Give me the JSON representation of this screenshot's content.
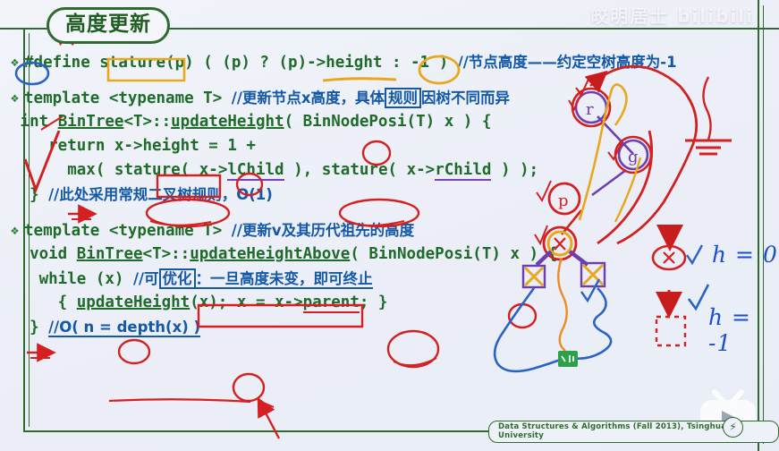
{
  "slide": {
    "title": "高度更新",
    "footer_note": "Data Structures & Algorithms (Fall 2013), Tsinghua University",
    "footer_badge_icon": "lightning-icon",
    "watermark_top": "皎明居士 bilibili",
    "watermark_logo_icon": "bilibili-tv-play-icon"
  },
  "colors": {
    "frame_green": "#2f6b2f",
    "code_green": "#1e6b2a",
    "comment_blue": "#1458a8",
    "ink_red": "#d42020",
    "ink_blue": "#1a4fd0",
    "ink_orange": "#e8a81c",
    "ink_purple": "#7b3fbf",
    "background": "#eef1f8"
  },
  "code": {
    "bullet_glyph": "❖",
    "lines": [
      {
        "id": "line-define",
        "bullet": true,
        "segments": [
          {
            "t": "#define ",
            "k": "code"
          },
          {
            "t": "stature",
            "k": "code"
          },
          {
            "t": "(p) ( (p) ? (p)->",
            "k": "code"
          },
          {
            "t": "height",
            "k": "code"
          },
          {
            "t": " : ",
            "k": "code"
          },
          {
            "t": "-1",
            "k": "code"
          },
          {
            "t": " ) ",
            "k": "code"
          },
          {
            "t": "//节点高度——约定空树高度为-1",
            "k": "cn"
          }
        ]
      },
      {
        "id": "line-template-1",
        "bullet": true,
        "segments": [
          {
            "t": "template <typename T> ",
            "k": "code"
          },
          {
            "t": "//更新节点x高度，具体",
            "k": "cn"
          },
          {
            "t": "规则",
            "k": "cn-box"
          },
          {
            "t": "因树不同而异",
            "k": "cn"
          }
        ]
      },
      {
        "id": "line-updateheight-sig",
        "bullet": false,
        "segments": [
          {
            "t": " int ",
            "k": "code"
          },
          {
            "t": "BinTree",
            "k": "code-ul"
          },
          {
            "t": "<T>::",
            "k": "code"
          },
          {
            "t": "updateHeight",
            "k": "code-ul"
          },
          {
            "t": "( BinNodePosi(T) x ) {",
            "k": "code"
          }
        ]
      },
      {
        "id": "line-return-height",
        "bullet": false,
        "segments": [
          {
            "t": "    return x->",
            "k": "code"
          },
          {
            "t": "height",
            "k": "code"
          },
          {
            "t": " = ",
            "k": "code"
          },
          {
            "t": "1",
            "k": "code"
          },
          {
            "t": " +",
            "k": "code"
          }
        ]
      },
      {
        "id": "line-max-stature",
        "bullet": false,
        "segments": [
          {
            "t": "      max( ",
            "k": "code"
          },
          {
            "t": "stature",
            "k": "code"
          },
          {
            "t": "( x->",
            "k": "code"
          },
          {
            "t": "lChild",
            "k": "code-ul-purple"
          },
          {
            "t": " ), ",
            "k": "code"
          },
          {
            "t": "stature",
            "k": "code"
          },
          {
            "t": "( x->",
            "k": "code"
          },
          {
            "t": "rChild",
            "k": "code-ul-purple"
          },
          {
            "t": " ) );",
            "k": "code"
          }
        ]
      },
      {
        "id": "line-close-1",
        "bullet": false,
        "segments": [
          {
            "t": "  } ",
            "k": "code"
          },
          {
            "t": "//此处采用常规二叉树规则，O(1)",
            "k": "cn"
          }
        ]
      },
      {
        "id": "line-template-2",
        "bullet": true,
        "segments": [
          {
            "t": "template <typename T> ",
            "k": "code"
          },
          {
            "t": "//更新v及其历代祖先的高度",
            "k": "cn"
          }
        ]
      },
      {
        "id": "line-updateheightabove-sig",
        "bullet": false,
        "segments": [
          {
            "t": "  void ",
            "k": "code"
          },
          {
            "t": "BinTree",
            "k": "code-ul"
          },
          {
            "t": "<T>::",
            "k": "code"
          },
          {
            "t": "updateHeightAbove",
            "k": "code-ul"
          },
          {
            "t": "( BinNodePosi(T) x ) {",
            "k": "code"
          }
        ]
      },
      {
        "id": "line-while",
        "bullet": false,
        "segments": [
          {
            "t": "   while ",
            "k": "code"
          },
          {
            "t": "(x)",
            "k": "code"
          },
          {
            "t": " ",
            "k": "code"
          },
          {
            "t": "//可",
            "k": "cn"
          },
          {
            "t": "优化",
            "k": "cn-box"
          },
          {
            "t": "：一旦高度未变，即可终止",
            "k": "cn-ul"
          }
        ]
      },
      {
        "id": "line-body",
        "bullet": false,
        "segments": [
          {
            "t": "     { ",
            "k": "code"
          },
          {
            "t": "updateHeight",
            "k": "code-ul"
          },
          {
            "t": "(x); x = x->",
            "k": "code"
          },
          {
            "t": "parent",
            "k": "code-ul-red"
          },
          {
            "t": "; }",
            "k": "code"
          }
        ]
      },
      {
        "id": "line-close-2",
        "bullet": false,
        "segments": [
          {
            "t": "  } ",
            "k": "code"
          },
          {
            "t": "//O( n = depth(x) )",
            "k": "cn-ul"
          }
        ]
      }
    ]
  },
  "annotations": {
    "legend": [
      {
        "id": "legend-h0",
        "label": "h = 0",
        "shape": "circled-x-node",
        "check": true
      },
      {
        "id": "legend-hneg",
        "label": "h = -1",
        "shape": "dashed-empty-square",
        "check": true
      }
    ],
    "tree_nodes": [
      {
        "id": "node-r",
        "label": "r",
        "check": true
      },
      {
        "id": "node-g",
        "label": "g",
        "check": true
      },
      {
        "id": "node-p",
        "label": "p",
        "check": true
      },
      {
        "id": "node-x",
        "label": "x",
        "check": true
      }
    ],
    "circled_terms": [
      "#define",
      "stature",
      "-1",
      "height",
      "1",
      "stature(lChild)",
      "stature(rChild)",
      "x",
      "updateHeightAbove",
      "(x)",
      "终止",
      "(x) in updateHeight"
    ]
  }
}
